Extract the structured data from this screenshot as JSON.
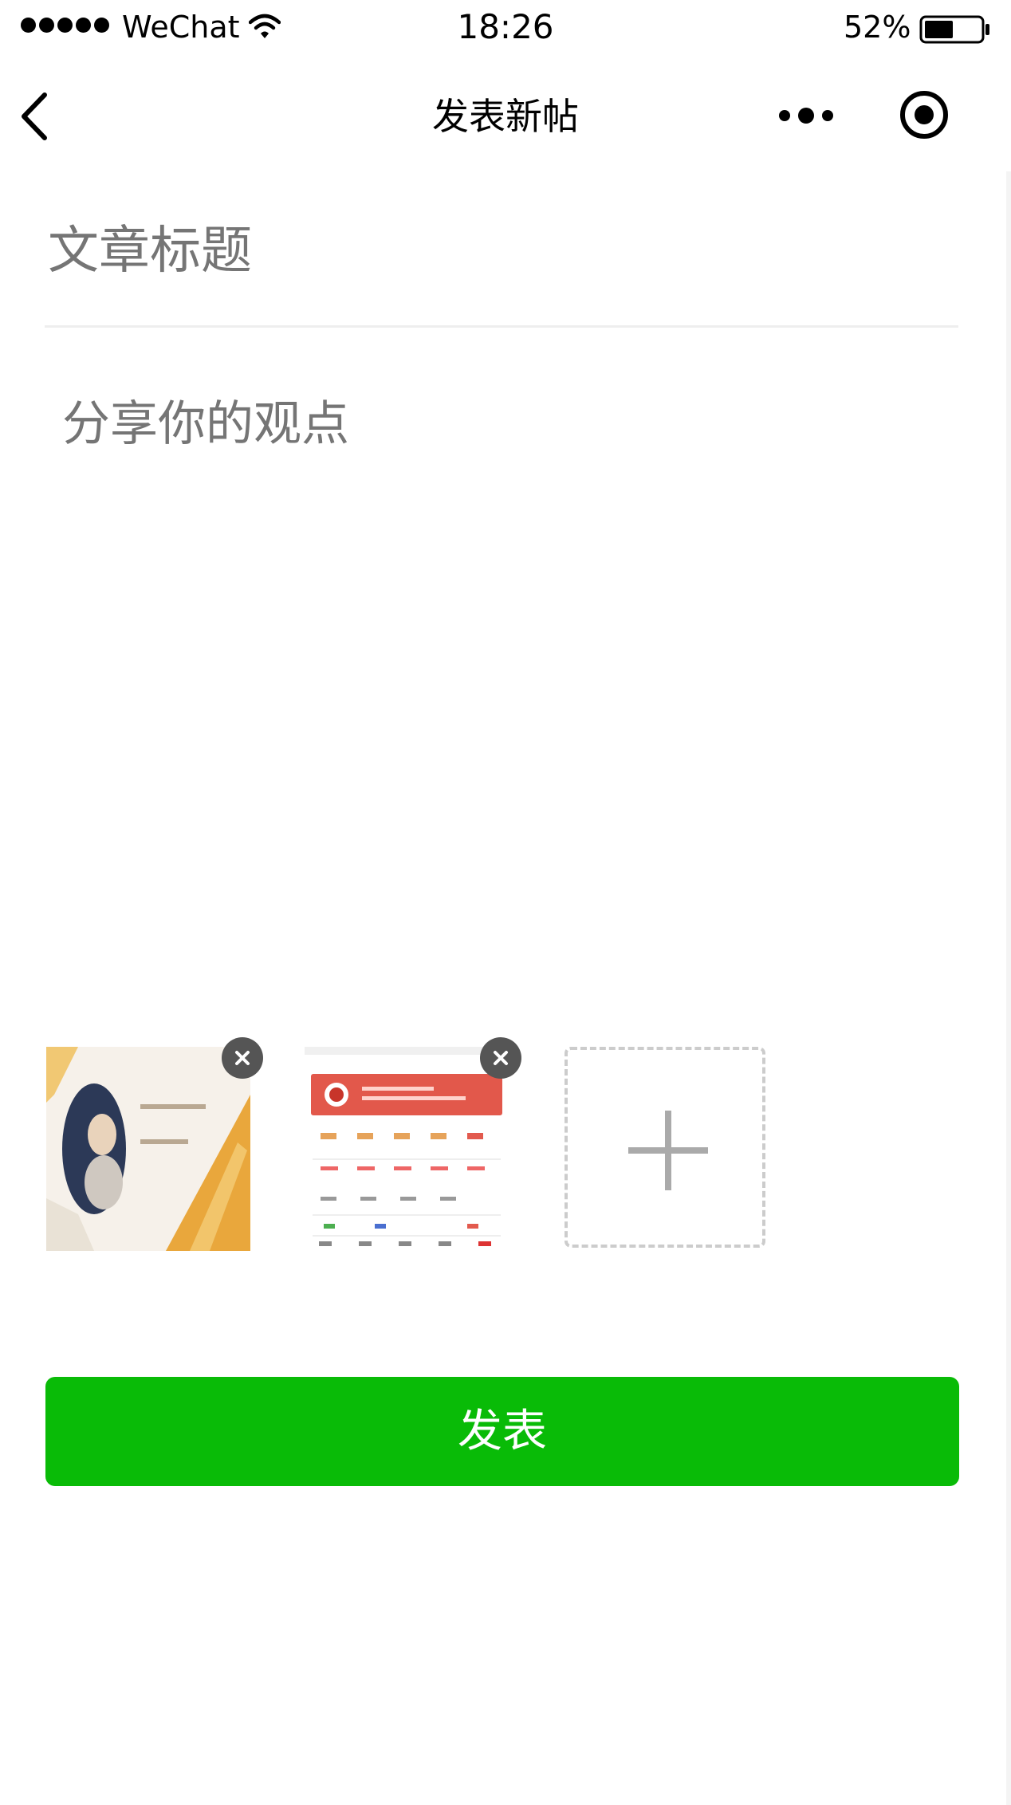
{
  "status_bar": {
    "carrier": "WeChat",
    "time": "18:26",
    "battery_percent": "52%",
    "battery_level": 0.52
  },
  "nav": {
    "title": "发表新帖"
  },
  "form": {
    "title_placeholder": "文章标题",
    "content_placeholder": "分享你的观点"
  },
  "images": {
    "count": 2,
    "thumbnails": [
      {
        "kind": "photo",
        "colors": [
          "#e8a63a",
          "#2a3a5a",
          "#f5efe6"
        ]
      },
      {
        "kind": "app-screenshot",
        "colors": [
          "#e0564a",
          "#ffffff"
        ]
      }
    ]
  },
  "actions": {
    "publish_label": "发表"
  },
  "colors": {
    "primary": "#09bb07",
    "badge": "#555555",
    "placeholder": "#888888",
    "divider": "#eeeeee"
  }
}
